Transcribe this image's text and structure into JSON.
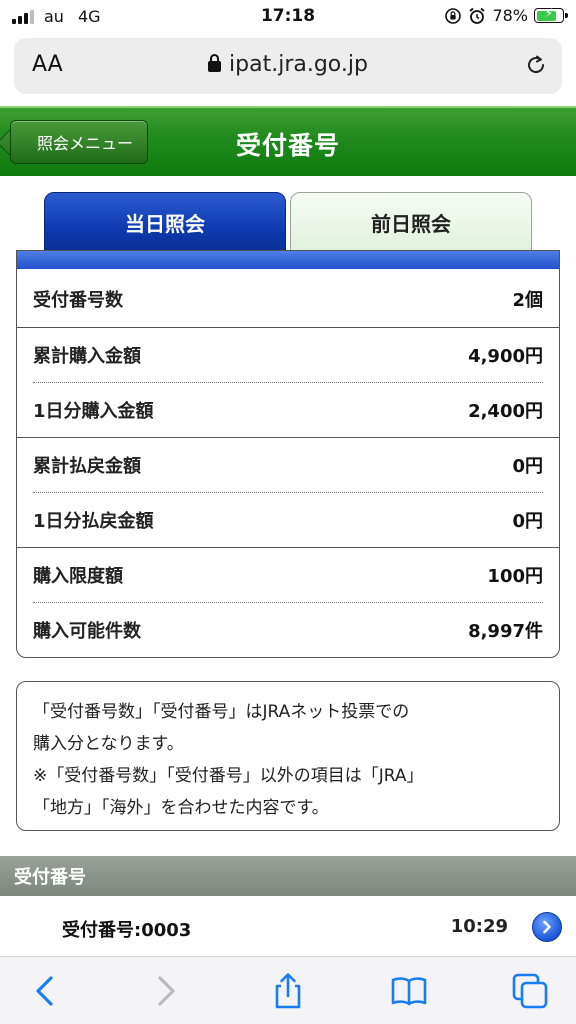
{
  "status_bar": {
    "carrier": "au",
    "network": "4G",
    "time": "17:18",
    "battery": "78%",
    "battery_level": 0.78
  },
  "browser": {
    "text_size_label": "AA",
    "url": "ipat.jra.go.jp"
  },
  "header": {
    "back_label": "照会メニュー",
    "title": "受付番号"
  },
  "tabs": [
    {
      "label": "当日照会",
      "active": true
    },
    {
      "label": "前日照会",
      "active": false
    }
  ],
  "summary": [
    {
      "label": "受付番号数",
      "value": "2個"
    },
    {
      "label": "累計購入金額",
      "value": "4,900円"
    },
    {
      "label": "1日分購入金額",
      "value": "2,400円"
    },
    {
      "label": "累計払戻金額",
      "value": "0円"
    },
    {
      "label": "1日分払戻金額",
      "value": "0円"
    },
    {
      "label": "購入限度額",
      "value": "100円"
    },
    {
      "label": "購入可能件数",
      "value": "8,997件"
    }
  ],
  "note": {
    "line1": "「受付番号数」「受付番号」はJRAネット投票での",
    "line2": "購入分となります。",
    "line3": "※「受付番号数」「受付番号」以外の項目は「JRA」",
    "line4": "「地方」「海外」を合わせた内容です。"
  },
  "section": {
    "title": "受付番号"
  },
  "receipts": [
    {
      "label": "受付番号:0003",
      "time": "10:29"
    }
  ],
  "colors": {
    "header_green": "#1f8a1c",
    "tab_blue": "#0e3bb0",
    "browser_blue": "#1a7cf5"
  }
}
